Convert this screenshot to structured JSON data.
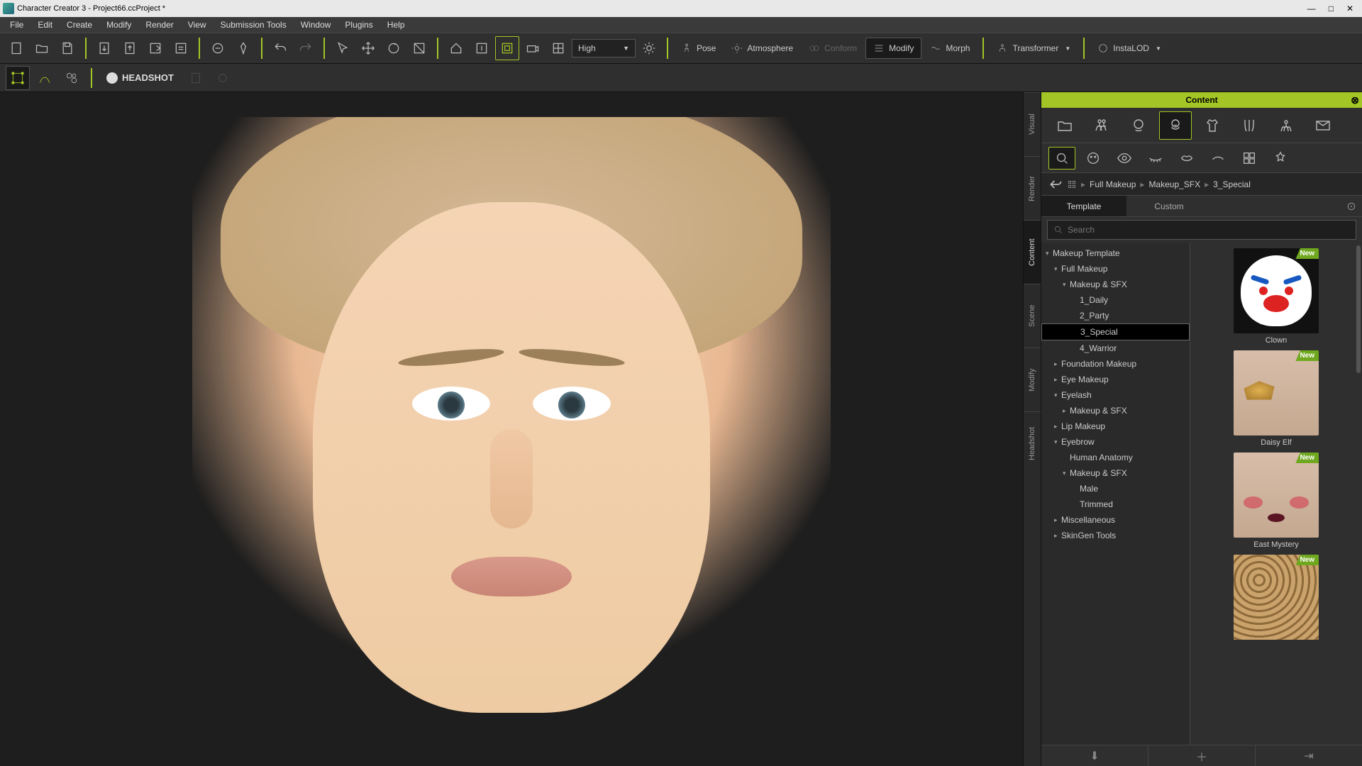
{
  "title": "Character Creator 3 - Project66.ccProject *",
  "menu": [
    "File",
    "Edit",
    "Create",
    "Modify",
    "Render",
    "View",
    "Submission Tools",
    "Window",
    "Plugins",
    "Help"
  ],
  "quality": "High",
  "toolbar_labels": {
    "pose": "Pose",
    "atmosphere": "Atmosphere",
    "conform": "Conform",
    "modify": "Modify",
    "morph": "Morph",
    "transformer": "Transformer",
    "instalod": "InstaLOD"
  },
  "headshot_label": "HEADSHOT",
  "vtabs": [
    "Visual",
    "Render",
    "Content",
    "Scene",
    "Modify",
    "Headshot"
  ],
  "panel_title": "Content",
  "breadcrumb": [
    "Full Makeup",
    "Makeup_SFX",
    "3_Special"
  ],
  "tc_tabs": {
    "template": "Template",
    "custom": "Custom"
  },
  "search_placeholder": "Search",
  "tree": [
    {
      "label": "Makeup Template",
      "indent": 0,
      "arrow": "▾"
    },
    {
      "label": "Full Makeup",
      "indent": 1,
      "arrow": "▾"
    },
    {
      "label": "Makeup & SFX",
      "indent": 2,
      "arrow": "▾"
    },
    {
      "label": "1_Daily",
      "indent": 3,
      "arrow": ""
    },
    {
      "label": "2_Party",
      "indent": 3,
      "arrow": ""
    },
    {
      "label": "3_Special",
      "indent": 3,
      "arrow": "",
      "selected": true
    },
    {
      "label": "4_Warrior",
      "indent": 3,
      "arrow": ""
    },
    {
      "label": "Foundation Makeup",
      "indent": 1,
      "arrow": "▸"
    },
    {
      "label": "Eye Makeup",
      "indent": 1,
      "arrow": "▸"
    },
    {
      "label": "Eyelash",
      "indent": 1,
      "arrow": "▾"
    },
    {
      "label": "Makeup & SFX",
      "indent": 2,
      "arrow": "▸"
    },
    {
      "label": "Lip Makeup",
      "indent": 1,
      "arrow": "▸"
    },
    {
      "label": "Eyebrow",
      "indent": 1,
      "arrow": "▾"
    },
    {
      "label": "Human Anatomy",
      "indent": 2,
      "arrow": ""
    },
    {
      "label": "Makeup & SFX",
      "indent": 2,
      "arrow": "▾"
    },
    {
      "label": "Male",
      "indent": 3,
      "arrow": ""
    },
    {
      "label": "Trimmed",
      "indent": 3,
      "arrow": ""
    },
    {
      "label": "Miscellaneous",
      "indent": 1,
      "arrow": "▸"
    },
    {
      "label": "SkinGen Tools",
      "indent": 1,
      "arrow": "▸"
    }
  ],
  "thumbs": [
    {
      "label": "Clown",
      "badge": "New",
      "kind": "clown"
    },
    {
      "label": "Daisy Elf",
      "badge": "New",
      "kind": "elf"
    },
    {
      "label": "East Mystery",
      "badge": "New",
      "kind": "mystery"
    },
    {
      "label": "",
      "badge": "New",
      "kind": "leopard"
    }
  ]
}
